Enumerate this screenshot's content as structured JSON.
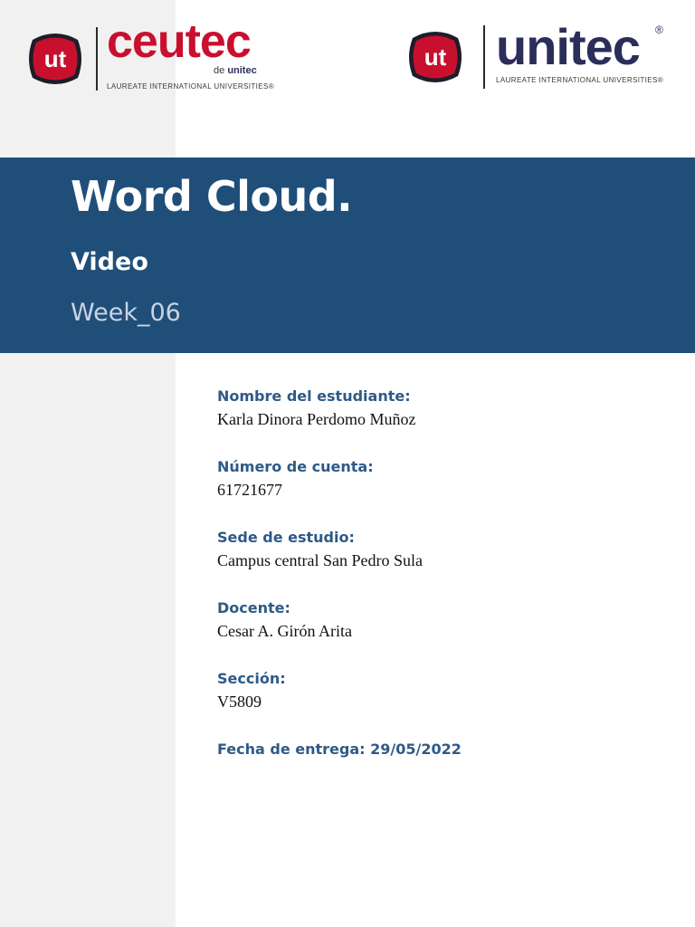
{
  "logos": {
    "ceutec": {
      "badge": "ut",
      "name": "ceutec",
      "de_text": "de",
      "de_brand": "unitec",
      "tagline": "LAUREATE INTERNATIONAL UNIVERSITIES®"
    },
    "unitec": {
      "badge": "ut",
      "name": "unitec",
      "registered": "®",
      "tagline": "LAUREATE INTERNATIONAL UNIVERSITIES®"
    }
  },
  "cover": {
    "title": "Word Cloud.",
    "subtitle": "Video",
    "week": "Week_06"
  },
  "fields": [
    {
      "label": "Nombre del estudiante:",
      "value": "Karla Dinora Perdomo Muñoz"
    },
    {
      "label": "Número de cuenta:",
      "value": "61721677"
    },
    {
      "label": "Sede de estudio:",
      "value": "Campus central San Pedro Sula"
    },
    {
      "label": "Docente:",
      "value": "Cesar A. Girón Arita"
    },
    {
      "label": "Sección:",
      "value": "V5809"
    }
  ],
  "delivery": {
    "text": "Fecha de entrega: 29/05/2022"
  },
  "colors": {
    "band": "#1f4e79",
    "label": "#2e5a87",
    "ceutec_red": "#c8102e",
    "unitec_navy": "#2b2d5a",
    "side_strip": "#f1f1f1"
  }
}
